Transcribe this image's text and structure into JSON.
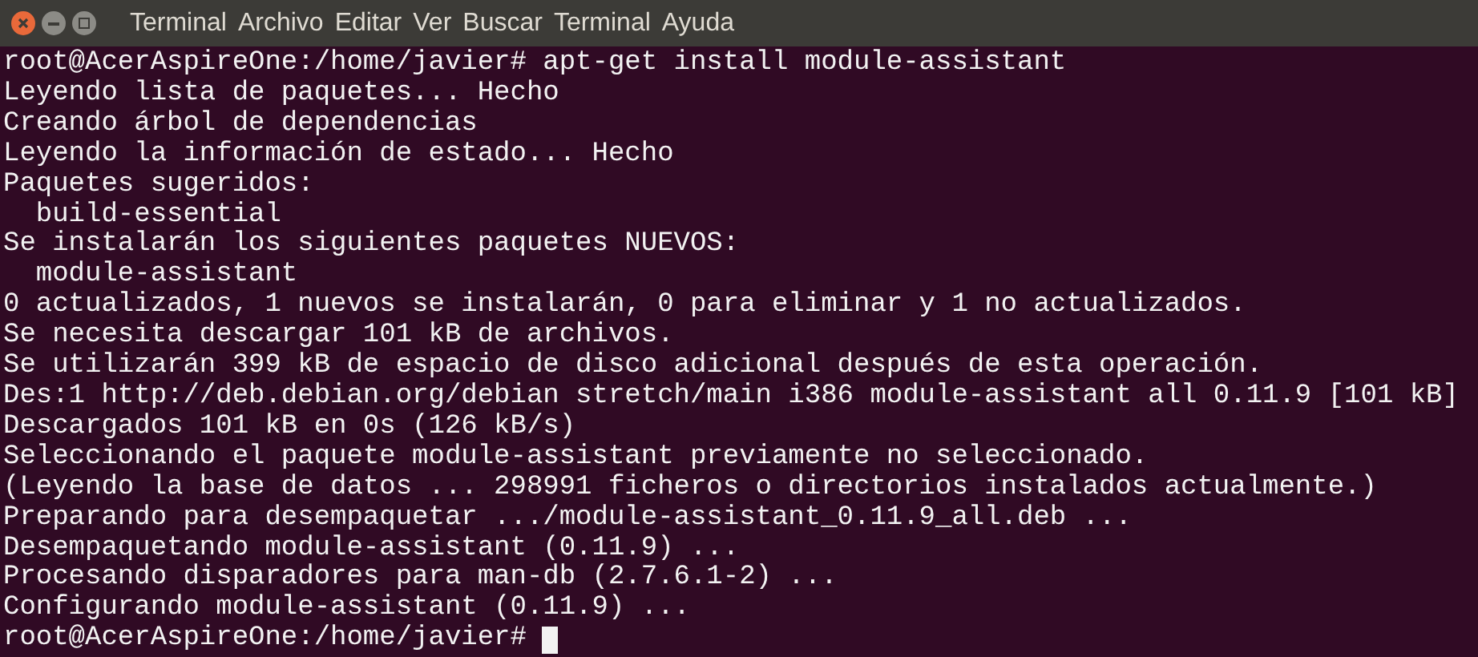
{
  "title_bar": {
    "app_name": "Terminal",
    "menu": [
      "Archivo",
      "Editar",
      "Ver",
      "Buscar",
      "Terminal",
      "Ayuda"
    ]
  },
  "terminal": {
    "lines": [
      "root@AcerAspireOne:/home/javier# apt-get install module-assistant",
      "Leyendo lista de paquetes... Hecho",
      "Creando árbol de dependencias",
      "Leyendo la información de estado... Hecho",
      "Paquetes sugeridos:",
      "  build-essential",
      "Se instalarán los siguientes paquetes NUEVOS:",
      "  module-assistant",
      "0 actualizados, 1 nuevos se instalarán, 0 para eliminar y 1 no actualizados.",
      "Se necesita descargar 101 kB de archivos.",
      "Se utilizarán 399 kB de espacio de disco adicional después de esta operación.",
      "Des:1 http://deb.debian.org/debian stretch/main i386 module-assistant all 0.11.9 [101 kB]",
      "Descargados 101 kB en 0s (126 kB/s)",
      "Seleccionando el paquete module-assistant previamente no seleccionado.",
      "(Leyendo la base de datos ... 298991 ficheros o directorios instalados actualmente.)",
      "Preparando para desempaquetar .../module-assistant_0.11.9_all.deb ...",
      "Desempaquetando module-assistant (0.11.9) ...",
      "Procesando disparadores para man-db (2.7.6.1-2) ...",
      "Configurando module-assistant (0.11.9) ..."
    ],
    "prompt": "root@AcerAspireOne:/home/javier#",
    "cursor": true
  }
}
